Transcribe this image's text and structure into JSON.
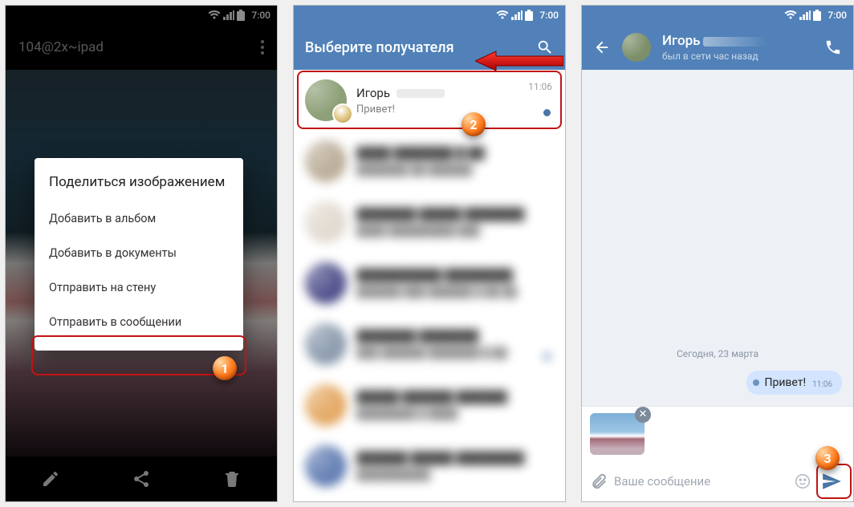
{
  "statusbar": {
    "time": "7:00"
  },
  "phone1": {
    "title": "104@2x~ipad",
    "dialog": {
      "title": "Поделиться изображением",
      "items": [
        "Добавить в альбом",
        "Добавить в документы",
        "Отправить на стену",
        "Отправить в сообщении"
      ]
    }
  },
  "phone2": {
    "title": "Выберите получателя",
    "first_row": {
      "name": "Игорь",
      "sub": "Привет!",
      "time": "11:06"
    }
  },
  "phone3": {
    "header": {
      "name": "Игорь",
      "status": "был в сети час назад"
    },
    "day": "Сегодня, 23 марта",
    "msg": {
      "text": "Привет!",
      "time": "11:06"
    },
    "placeholder": "Ваше сообщение"
  },
  "balls": {
    "b1": "1",
    "b2": "2",
    "b3": "3"
  }
}
